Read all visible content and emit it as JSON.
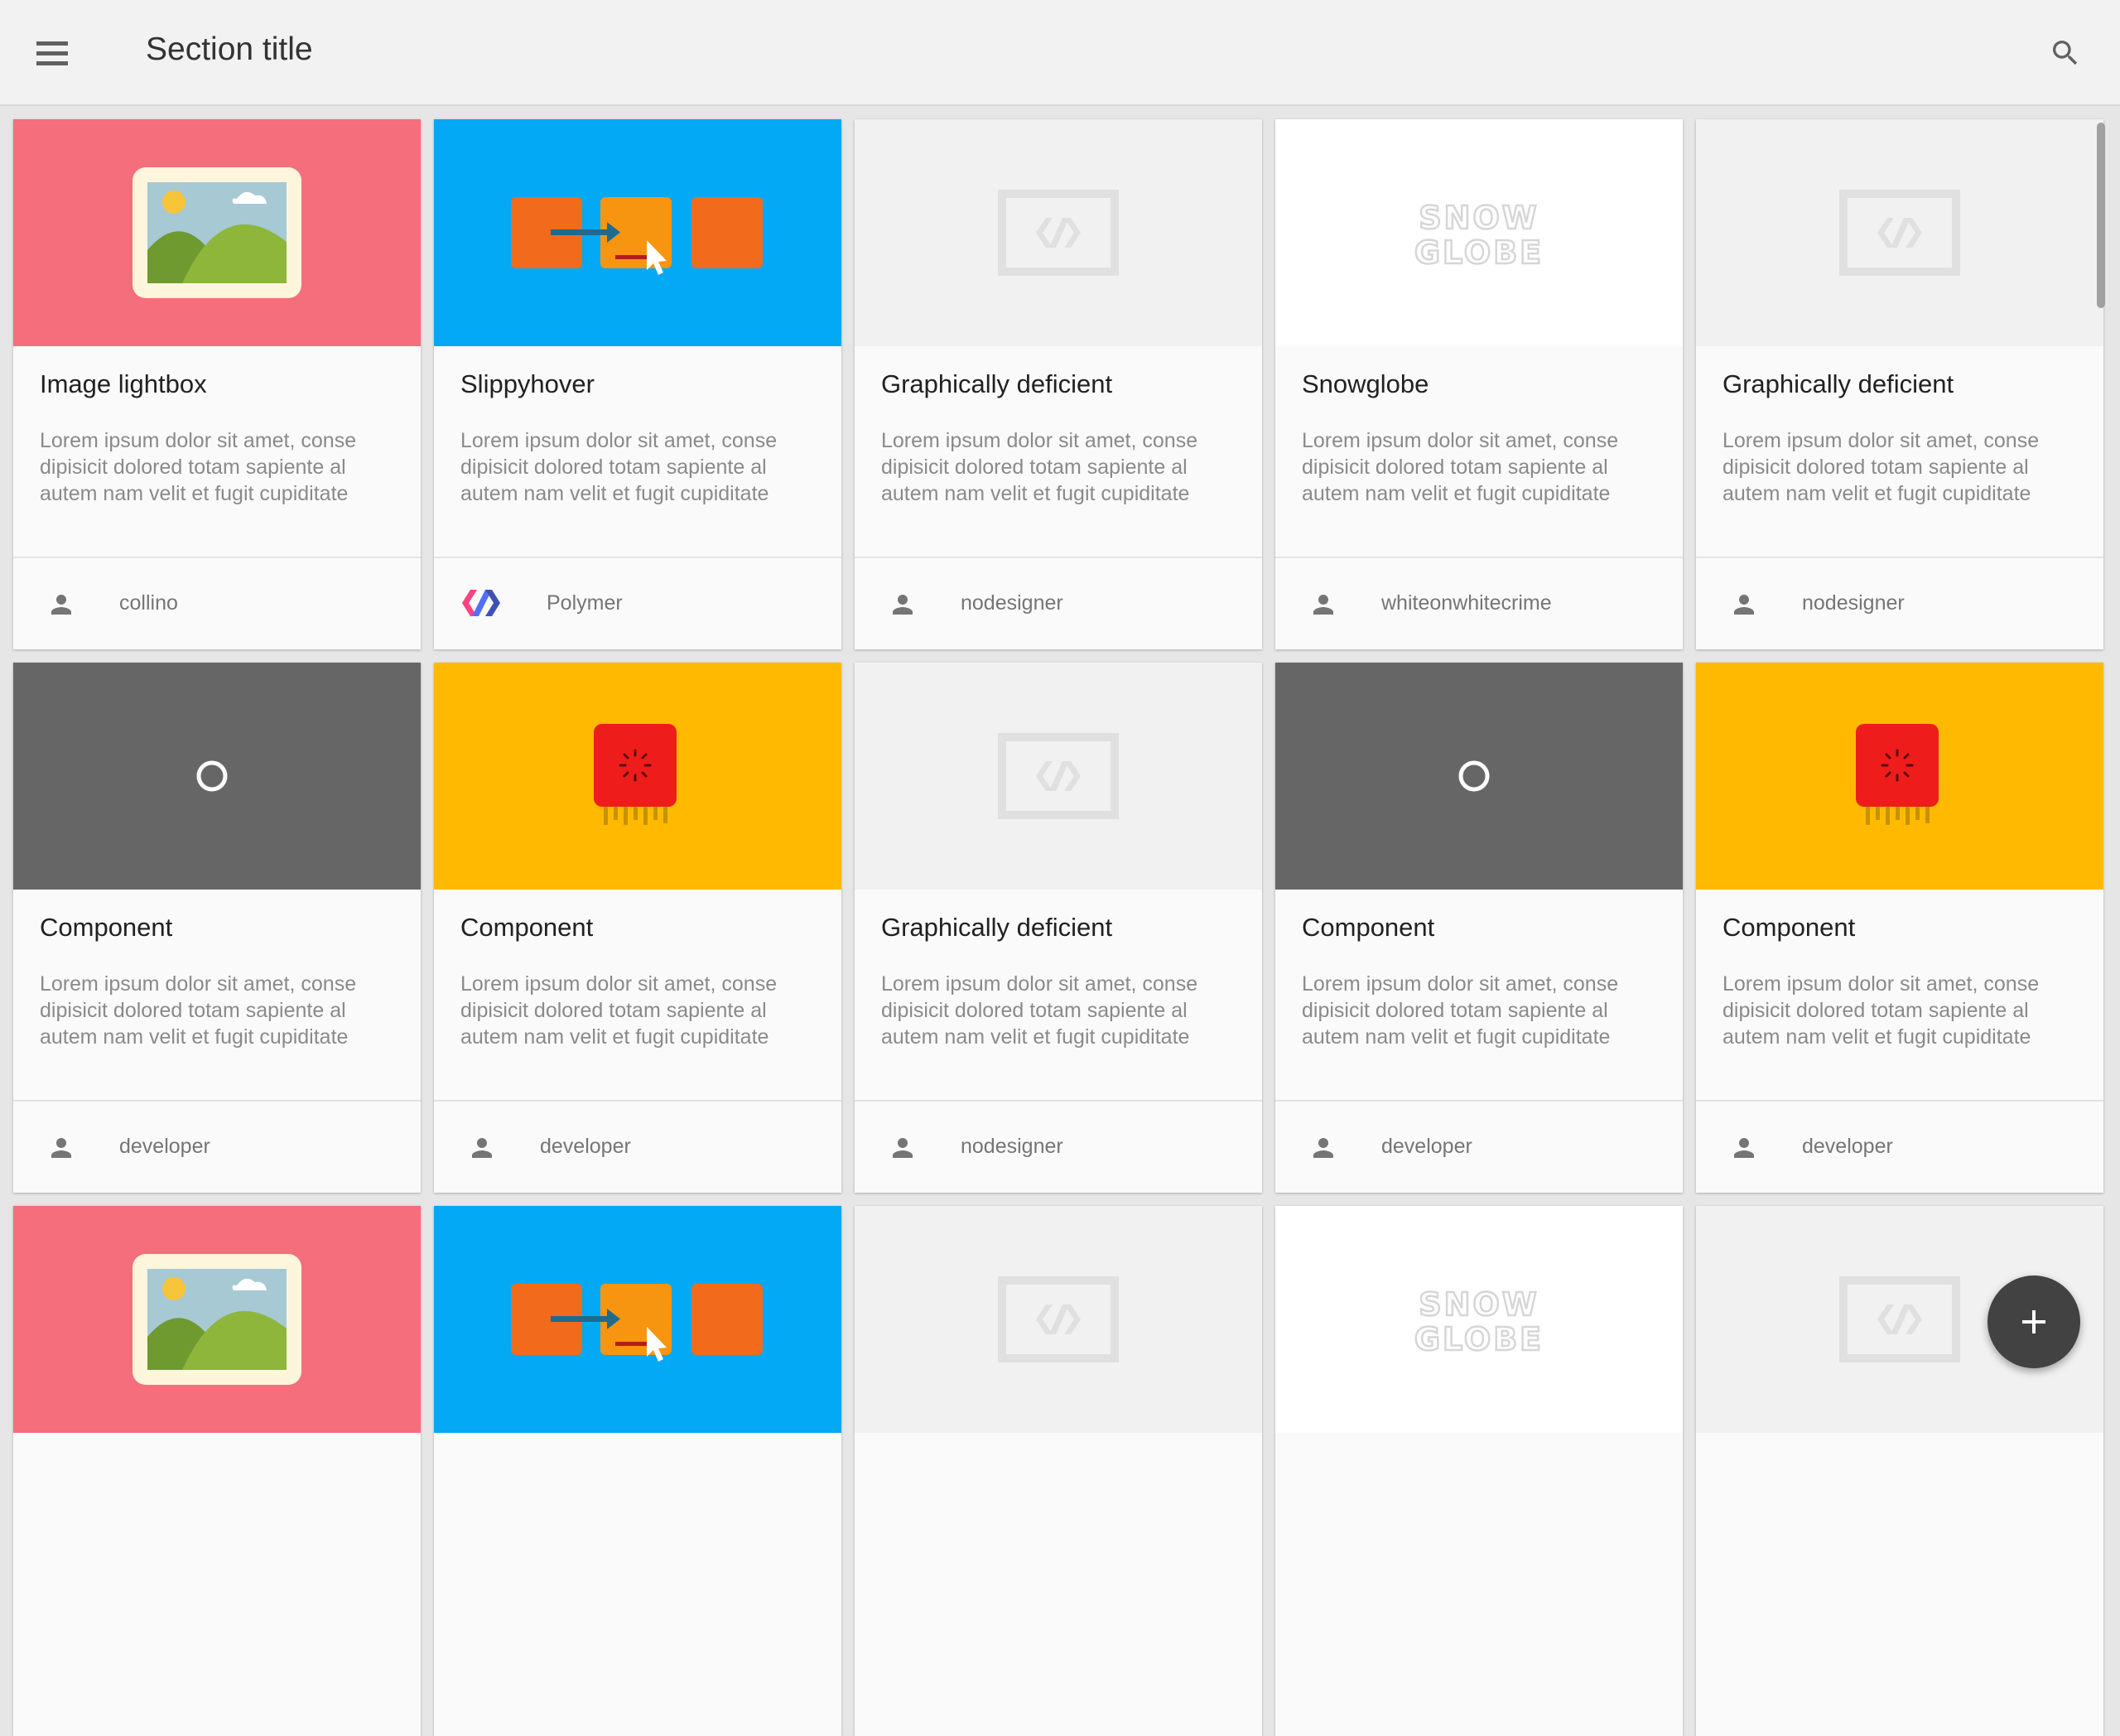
{
  "toolbar": {
    "title": "Section title",
    "menu_icon": "menu-icon",
    "search_icon": "search-icon"
  },
  "cards": [
    {
      "title": "Image lightbox",
      "description": "Lorem ipsum dolor sit amet, conse dipisicit dolored totam sapiente al autem nam velit et fugit cupiditate",
      "author": "collino",
      "thumb": "image-lightbox",
      "avatar": "person-icon"
    },
    {
      "title": "Slippyhover",
      "description": "Lorem ipsum dolor sit amet, conse dipisicit dolored totam sapiente al autem nam velit et fugit cupiditate",
      "author": "Polymer",
      "thumb": "slippyhover",
      "avatar": "polymer-logo"
    },
    {
      "title": "Graphically deficient",
      "description": "Lorem ipsum dolor sit amet, conse dipisicit dolored totam sapiente al autem nam velit et fugit cupiditate",
      "author": "nodesigner",
      "thumb": "placeholder",
      "avatar": "person-icon"
    },
    {
      "title": "Snowglobe",
      "description": "Lorem ipsum dolor sit amet, conse dipisicit dolored totam sapiente al autem nam velit et fugit cupiditate",
      "author": "whiteonwhitecrime",
      "thumb": "snowglobe",
      "avatar": "person-icon"
    },
    {
      "title": "Graphically deficient",
      "description": "Lorem ipsum dolor sit amet, conse dipisicit dolored totam sapiente al autem nam velit et fugit cupiditate",
      "author": "nodesigner",
      "thumb": "placeholder",
      "avatar": "person-icon"
    },
    {
      "title": "Component",
      "description": "Lorem ipsum dolor sit amet, conse dipisicit dolored totam sapiente al autem nam velit et fugit cupiditate",
      "author": "developer",
      "thumb": "ring",
      "avatar": "person-icon"
    },
    {
      "title": "Component",
      "description": "Lorem ipsum dolor sit amet, conse dipisicit dolored totam sapiente al autem nam velit et fugit cupiditate",
      "author": "developer",
      "thumb": "spinner-chip",
      "avatar": "person-icon"
    },
    {
      "title": "Graphically deficient",
      "description": "Lorem ipsum dolor sit amet, conse dipisicit dolored totam sapiente al autem nam velit et fugit cupiditate",
      "author": "nodesigner",
      "thumb": "placeholder",
      "avatar": "person-icon"
    },
    {
      "title": "Component",
      "description": "Lorem ipsum dolor sit amet, conse dipisicit dolored totam sapiente al autem nam velit et fugit cupiditate",
      "author": "developer",
      "thumb": "ring",
      "avatar": "person-icon"
    },
    {
      "title": "Component",
      "description": "Lorem ipsum dolor sit amet, conse dipisicit dolored totam sapiente al autem nam velit et fugit cupiditate",
      "author": "developer",
      "thumb": "spinner-chip",
      "avatar": "person-icon"
    },
    {
      "title": "",
      "description": "",
      "author": "",
      "thumb": "image-lightbox",
      "avatar": ""
    },
    {
      "title": "",
      "description": "",
      "author": "",
      "thumb": "slippyhover",
      "avatar": ""
    },
    {
      "title": "",
      "description": "",
      "author": "",
      "thumb": "placeholder",
      "avatar": ""
    },
    {
      "title": "",
      "description": "",
      "author": "",
      "thumb": "snowglobe",
      "avatar": ""
    },
    {
      "title": "",
      "description": "",
      "author": "",
      "thumb": "placeholder",
      "avatar": ""
    }
  ],
  "snowglobe_logo": {
    "line1": "SNOW",
    "line2": "GLOBE"
  },
  "fab": {
    "icon": "plus-icon",
    "label": "+"
  },
  "colors": {
    "pink": "#f46e7c",
    "blue": "#03a9f4",
    "gray": "#f1f1f1",
    "white": "#ffffff",
    "dark": "#666666",
    "yellow": "#ffba00",
    "fab": "#424242",
    "toolbar": "#f2f2f2"
  }
}
